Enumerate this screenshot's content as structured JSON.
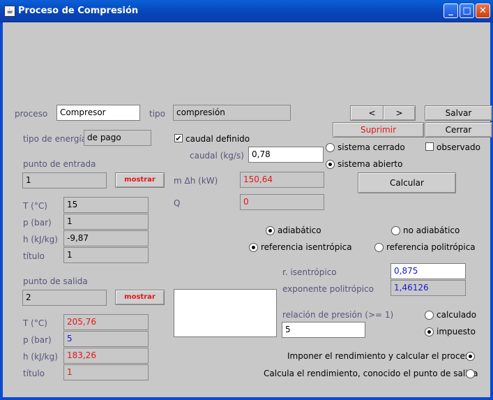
{
  "window": {
    "title": "Proceso de Compresión",
    "minimize": "_",
    "maximize": "□",
    "close": "✕"
  },
  "header": {
    "proceso_label": "proceso",
    "proceso_value": "Compresor",
    "tipo_label": "tipo",
    "tipo_value": "compresión",
    "prev": "<",
    "next": ">",
    "salvar": "Salvar",
    "suprimir": "Suprimir",
    "cerrar": "Cerrar"
  },
  "energy": {
    "label": "tipo de energía",
    "value": "de pago"
  },
  "entrada": {
    "label": "punto de entrada",
    "value": "1",
    "mostrar": "mostrar",
    "rows": [
      {
        "label": "T (°C)",
        "value": "15"
      },
      {
        "label": "p (bar)",
        "value": "1"
      },
      {
        "label": "h (kJ/kg)",
        "value": "-9,87"
      },
      {
        "label": "título",
        "value": "1"
      }
    ]
  },
  "salida": {
    "label": "punto de salida",
    "value": "2",
    "mostrar": "mostrar",
    "rows": [
      {
        "label": "T (°C)",
        "value": "205,76"
      },
      {
        "label": "p (bar)",
        "value": "5"
      },
      {
        "label": "h (kJ/kg)",
        "value": "183,26"
      },
      {
        "label": "título",
        "value": "1"
      }
    ]
  },
  "flow": {
    "caudal_definido": "caudal definido",
    "caudal_label": "caudal (kg/s)",
    "caudal_value": "0,78",
    "mdh_label": "m Δh (kW)",
    "mdh_value": "150,64",
    "q_label": "Q",
    "q_value": "0"
  },
  "system": {
    "cerrado": "sistema cerrado",
    "abierto": "sistema abierto",
    "observado": "observado",
    "calcular": "Calcular"
  },
  "process": {
    "adiabatico": "adiabático",
    "no_adiabatico": "no adiabático",
    "ref_isentropica": "referencia isentrópica",
    "ref_politropica": "referencia politrópica",
    "r_isentropico_label": "r. isentrópico",
    "r_isentropico_value": "0,875",
    "exp_politropico_label": "exponente politrópico",
    "exp_politropico_value": "1,46126",
    "relacion_label": "relación de presión (>= 1)",
    "relacion_value": "5",
    "calculado": "calculado",
    "impuesto": "impuesto",
    "imponer": "Imponer el rendimiento y calcular el proceso",
    "calcula": "Calcula el rendimiento, conocido el punto de salida"
  }
}
